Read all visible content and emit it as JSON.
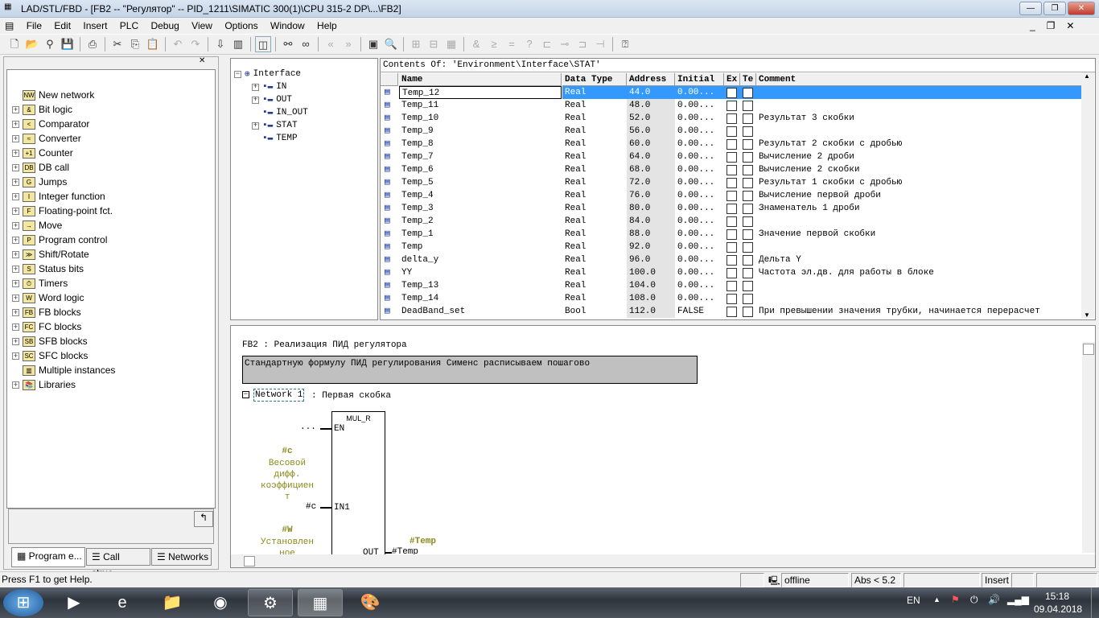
{
  "window": {
    "title": "LAD/STL/FBD  - [FB2 -- \"Регулятор\" -- PID_1211\\SIMATIC 300(1)\\CPU 315-2 DP\\...\\FB2]"
  },
  "menu": [
    "File",
    "Edit",
    "Insert",
    "PLC",
    "Debug",
    "View",
    "Options",
    "Window",
    "Help"
  ],
  "catalog": [
    "New network",
    "Bit logic",
    "Comparator",
    "Converter",
    "Counter",
    "DB call",
    "Jumps",
    "Integer function",
    "Floating-point fct.",
    "Move",
    "Program control",
    "Shift/Rotate",
    "Status bits",
    "Timers",
    "Word logic",
    "FB blocks",
    "FC blocks",
    "SFB blocks",
    "SFC blocks",
    "Multiple instances",
    "Libraries"
  ],
  "left_tabs": [
    "Program e...",
    "Call struc...",
    "Networks"
  ],
  "interface_tree": [
    "Interface",
    "IN",
    "OUT",
    "IN_OUT",
    "STAT",
    "TEMP"
  ],
  "table": {
    "contents_of": "Contents Of: 'Environment\\Interface\\STAT'",
    "headers": [
      "Name",
      "Data Type",
      "Address",
      "Initial",
      "Ex",
      "Te",
      "Comment"
    ],
    "rows": [
      [
        "Temp_12",
        "Real",
        "44.0",
        "0.00...",
        ""
      ],
      [
        "Temp_11",
        "Real",
        "48.0",
        "0.00...",
        ""
      ],
      [
        "Temp_10",
        "Real",
        "52.0",
        "0.00...",
        "Результат 3 скобки"
      ],
      [
        "Temp_9",
        "Real",
        "56.0",
        "0.00...",
        ""
      ],
      [
        "Temp_8",
        "Real",
        "60.0",
        "0.00...",
        "Результат 2 скобки с дробью"
      ],
      [
        "Temp_7",
        "Real",
        "64.0",
        "0.00...",
        "Вычисление 2 дроби"
      ],
      [
        "Temp_6",
        "Real",
        "68.0",
        "0.00...",
        "Вычисление 2 скобки"
      ],
      [
        "Temp_5",
        "Real",
        "72.0",
        "0.00...",
        "Результат 1 скобки с дробью"
      ],
      [
        "Temp_4",
        "Real",
        "76.0",
        "0.00...",
        "Вычисление первой дроби"
      ],
      [
        "Temp_3",
        "Real",
        "80.0",
        "0.00...",
        "Знаменатель 1 дроби"
      ],
      [
        "Temp_2",
        "Real",
        "84.0",
        "0.00...",
        ""
      ],
      [
        "Temp_1",
        "Real",
        "88.0",
        "0.00...",
        "Значение первой скобки"
      ],
      [
        "Temp",
        "Real",
        "92.0",
        "0.00...",
        ""
      ],
      [
        "delta_y",
        "Real",
        "96.0",
        "0.00...",
        "Дельта Y"
      ],
      [
        "YY",
        "Real",
        "100.0",
        "0.00...",
        "Частота эл.дв. для работы в блоке"
      ],
      [
        "Temp_13",
        "Real",
        "104.0",
        "0.00...",
        ""
      ],
      [
        "Temp_14",
        "Real",
        "108.0",
        "0.00...",
        ""
      ],
      [
        "DeadBand_set",
        "Bool",
        "112.0",
        "FALSE",
        "При превышении значения трубки, начинается перерасчет"
      ]
    ],
    "selected_row": 0
  },
  "editor": {
    "block_title": "FB2 : Реализация ПИД регулятора",
    "block_comment": "Стандартную формулу ПИД регулирования Сименс расписываем пошагово",
    "network_label": "Network 1",
    "network_title": ": Первая скобка",
    "box_name": "MUL_R",
    "en_input": "...",
    "en_pin": "EN",
    "in1_symbol": "#c",
    "in1_comment": [
      "Весовой",
      "дифф.",
      "коэффициен",
      "т"
    ],
    "in1_operand": "#c",
    "in1_pin": "IN1",
    "in2_symbol": "#W",
    "in2_comment": [
      "Установлен",
      "ное"
    ],
    "out_pin": "OUT",
    "out_symbol": "#Temp",
    "out_operand": "#Temp"
  },
  "status": {
    "help": "Press F1 to get Help.",
    "mode": "offline",
    "abs": "Abs < 5.2",
    "insert": "Insert"
  },
  "taskbar": {
    "lang": "EN",
    "time": "15:18",
    "date": "09.04.2018"
  },
  "colors": {
    "selection": "#3399ff",
    "symbol": "#8a8a1a"
  }
}
